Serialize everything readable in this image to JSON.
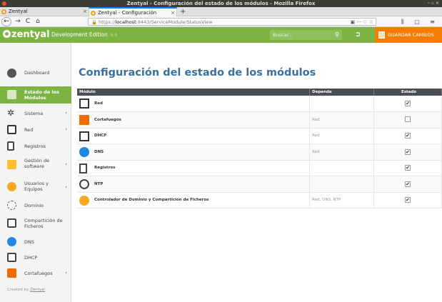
{
  "window": {
    "title": "Zentyal - Configuración del estado de los módulos - Mozilla Firefox",
    "controls": "– ▫ ×"
  },
  "tabs": [
    {
      "label": "Zentyal",
      "close": "×"
    },
    {
      "label": "Zentyal - Configuración",
      "close": "×"
    }
  ],
  "newtab": "+",
  "nav": {
    "back": "←",
    "forward": "→",
    "reload": "C",
    "home": "⌂",
    "url_prefix": "https://",
    "url_host": "localhost",
    "url_path": ":8443/ServiceModule/StatusView",
    "url_right": "▣ ··· ♡ ☆",
    "right_icons": "⫼ ▢ ≡"
  },
  "header": {
    "logo": "zentyal",
    "edition": "Development Edition",
    "version": "6.0",
    "search_placeholder": "Buscar...",
    "search_icon": "search-icon",
    "logout_icon": "logout-icon",
    "save_label": "GUARDAR CAMBIOS"
  },
  "sidebar": {
    "items": [
      {
        "label": "Dashboard",
        "icon": "dashboard-icon"
      },
      {
        "label": "Estado de los Módulos",
        "icon": "modules-icon"
      },
      {
        "label": "Sistema",
        "icon": "gear-icon",
        "arrow": "‹"
      },
      {
        "label": "Red",
        "icon": "network-icon",
        "arrow": "‹"
      },
      {
        "label": "Registros",
        "icon": "logs-icon"
      },
      {
        "label": "Gestión de software",
        "icon": "software-icon",
        "arrow": "‹"
      },
      {
        "label": "Usuarios y Equipos",
        "icon": "users-icon",
        "arrow": "‹"
      },
      {
        "label": "Dominio",
        "icon": "domain-icon"
      },
      {
        "label": "Compartición de Ficheros",
        "icon": "fileshare-icon"
      },
      {
        "label": "DNS",
        "icon": "dns-icon"
      },
      {
        "label": "DHCP",
        "icon": "dhcp-icon"
      },
      {
        "label": "Cortafuegos",
        "icon": "firewall-icon",
        "arrow": "‹"
      }
    ],
    "footer_prefix": "Created by",
    "footer_link": "Zentyal"
  },
  "main": {
    "title": "Configuración del estado de los módulos",
    "columns": [
      "Módulo",
      "Depende",
      "Estado"
    ],
    "rows": [
      {
        "name": "Red",
        "depends": "",
        "checked": true,
        "icon": "network-icon"
      },
      {
        "name": "Cortafuegos",
        "depends": "Red",
        "checked": false,
        "icon": "firewall-icon"
      },
      {
        "name": "DHCP",
        "depends": "Red",
        "checked": true,
        "icon": "dhcp-icon"
      },
      {
        "name": "DNS",
        "depends": "Red",
        "checked": true,
        "icon": "dns-icon"
      },
      {
        "name": "Registros",
        "depends": "",
        "checked": true,
        "icon": "logs-icon"
      },
      {
        "name": "NTP",
        "depends": "",
        "checked": true,
        "icon": "clock-icon"
      },
      {
        "name": "Controlador de Dominio y Compartición de Ficheros",
        "depends": "Red, DNS, NTP",
        "checked": true,
        "icon": "users-icon"
      }
    ]
  },
  "colors": {
    "accent": "#7cb342",
    "save": "#f57c00",
    "title": "#3a6fa0"
  }
}
